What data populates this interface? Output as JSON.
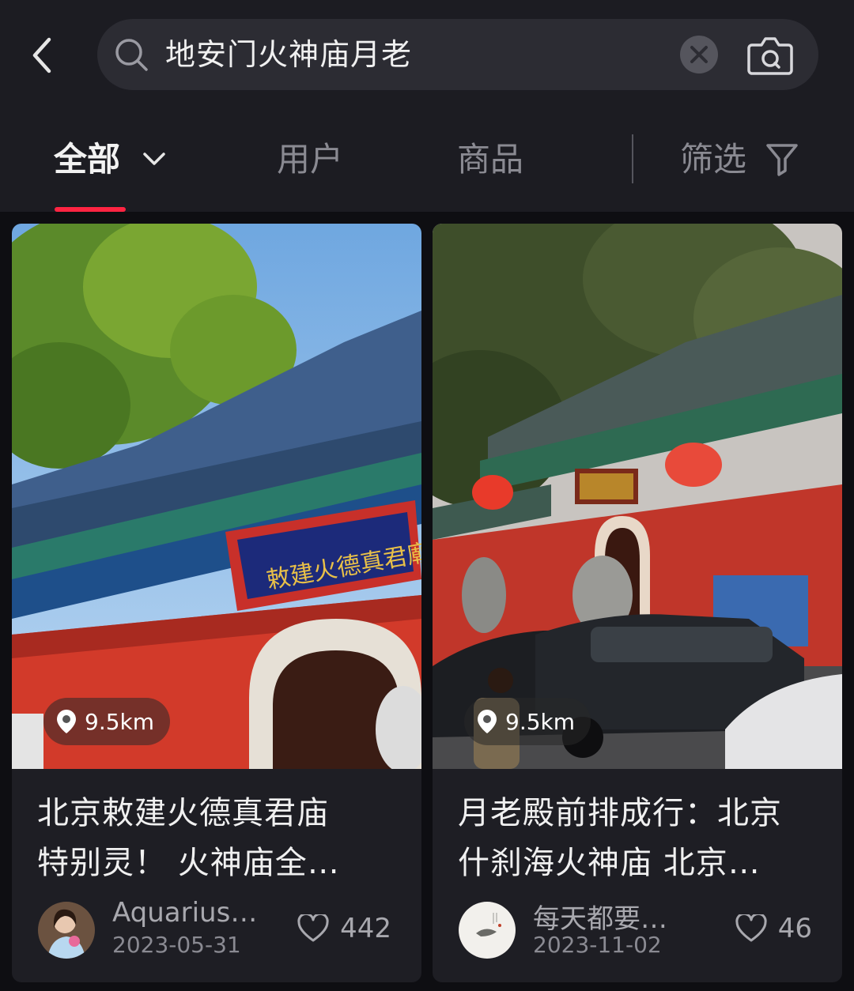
{
  "search": {
    "query": "地安门火神庙月老"
  },
  "tabs": [
    {
      "label": "全部"
    },
    {
      "label": "用户"
    },
    {
      "label": "商品"
    },
    {
      "label": "筛选"
    }
  ],
  "cards": [
    {
      "distance": "9.5km",
      "title_line1": "北京敕建火德真君庙",
      "title_line2": "特别灵！ 火神庙全…",
      "author": "Aquarius_w",
      "date": "2023-05-31",
      "likes": "442"
    },
    {
      "distance": "9.5km",
      "title_line1": "月老殿前排成行：北京",
      "title_line2": "什刹海火神庙 北京…",
      "author": "每天都要小…",
      "date": "2023-11-02",
      "likes": "46"
    }
  ],
  "colors": {
    "accent": "#ff2442",
    "background": "#0e0e12",
    "card": "#1e1e24"
  },
  "icons": [
    "back-arrow-icon",
    "search-icon",
    "clear-icon",
    "camera-icon",
    "chevron-down-icon",
    "filter-funnel-icon",
    "location-pin-icon",
    "heart-icon"
  ]
}
